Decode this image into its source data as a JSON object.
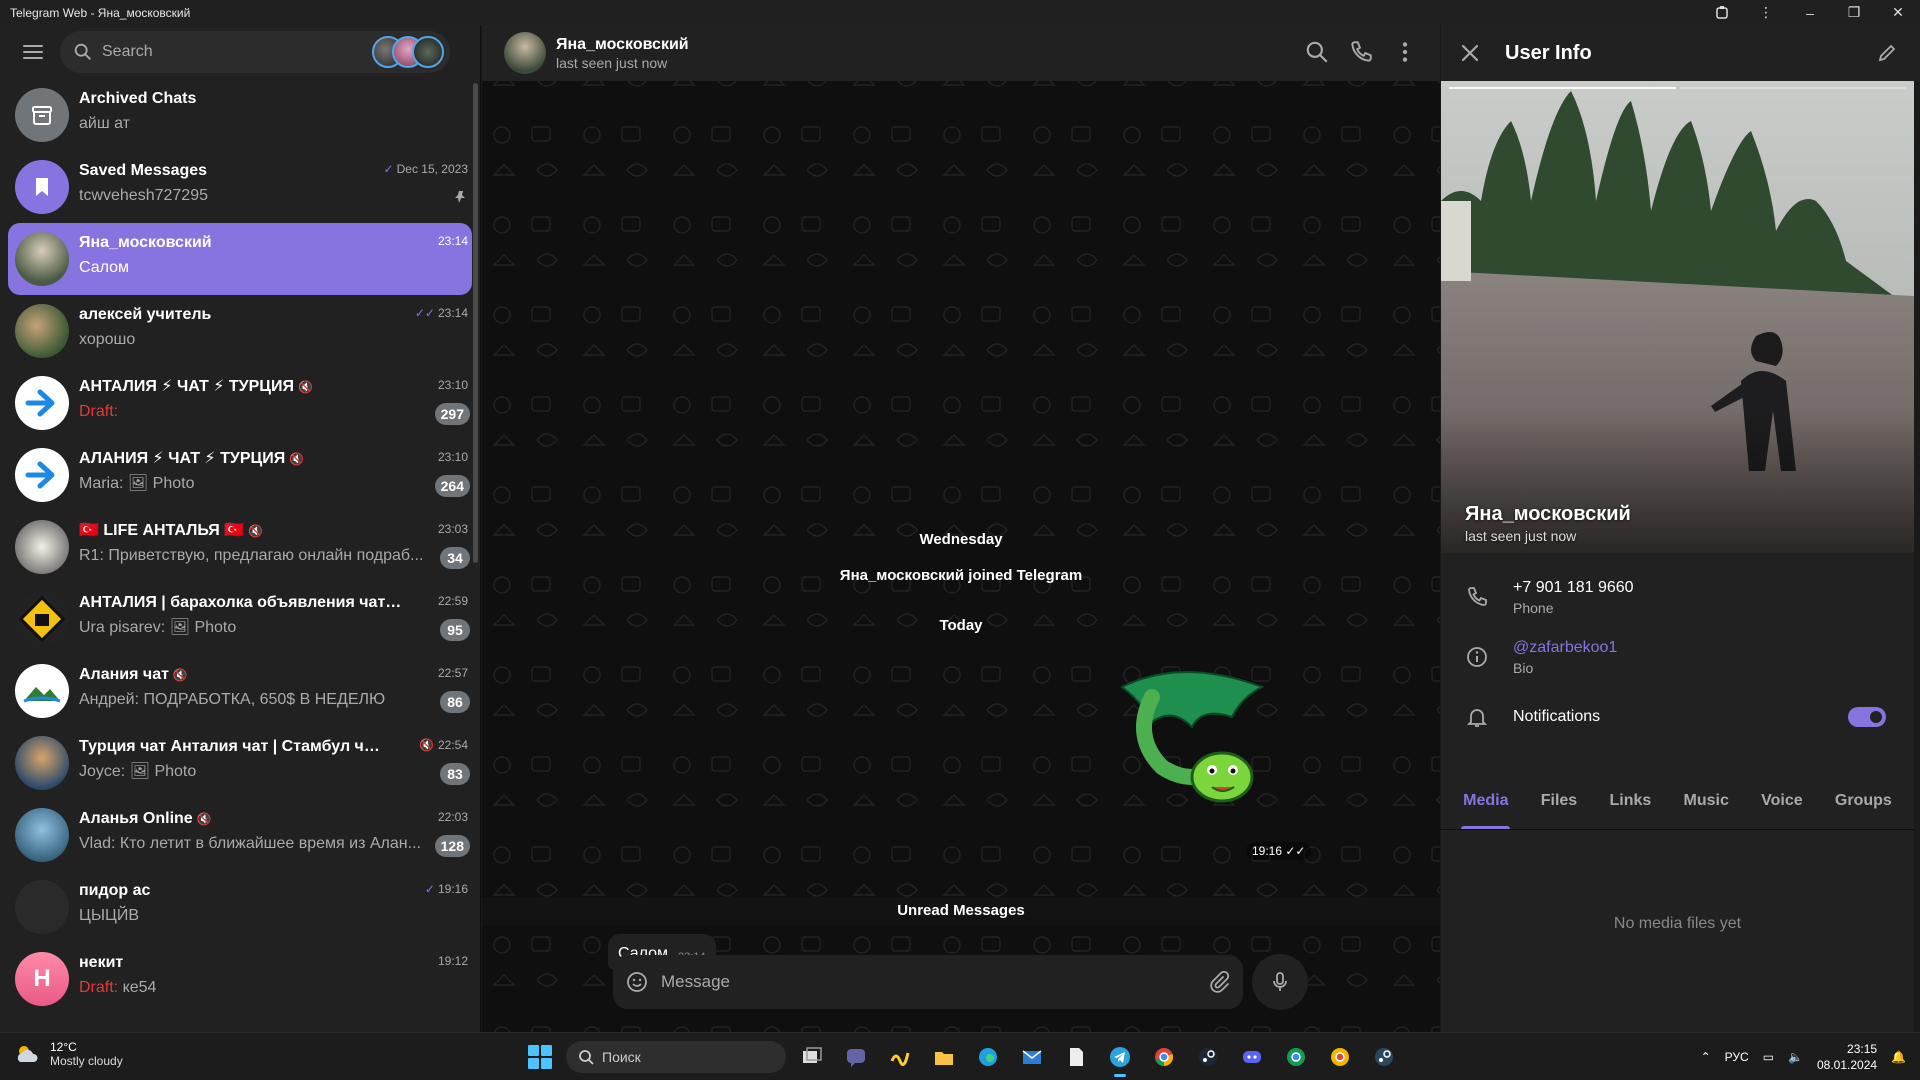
{
  "window": {
    "title": "Telegram Web - Яна_московский"
  },
  "sidebar": {
    "search_placeholder": "Search",
    "chats": [
      {
        "title": "Archived Chats",
        "subtitle": "айш ат",
        "time": "",
        "badge": "",
        "draft": ""
      },
      {
        "title": "Saved Messages",
        "subtitle": "tcwvehesh727295",
        "time": "Dec 15, 2023",
        "badge": "",
        "draft": ""
      },
      {
        "title": "Яна_московский",
        "subtitle": "Салом",
        "time": "23:14",
        "badge": "",
        "draft": ""
      },
      {
        "title": "алексей учитель",
        "subtitle": "хорошо",
        "time": "23:14",
        "badge": "",
        "draft": ""
      },
      {
        "title": "АНТАЛИЯ ⚡ ЧАТ ⚡ ТУРЦИЯ",
        "subtitle": "",
        "time": "23:10",
        "badge": "297",
        "draft": "Draft:"
      },
      {
        "title": "АЛАНИЯ ⚡ ЧАТ ⚡ ТУРЦИЯ",
        "subtitle": "Maria: 🖼 Photo",
        "time": "23:10",
        "badge": "264",
        "draft": ""
      },
      {
        "title": "🇹🇷 LIFE АНТАЛЬЯ 🇹🇷",
        "subtitle": "R1: Приветствую, предлагаю онлайн подраб...",
        "time": "23:03",
        "badge": "34",
        "draft": ""
      },
      {
        "title": "АНТАЛИЯ | барахолка объявления чат",
        "subtitle": "Ura pisarev: 🖼 Photo",
        "time": "22:59",
        "badge": "95",
        "draft": ""
      },
      {
        "title": "Алания чат",
        "subtitle": "Андрей: ПОДРАБОТКА, 650$ В НЕДЕЛЮ",
        "time": "22:57",
        "badge": "86",
        "draft": ""
      },
      {
        "title": "Турция чат Анталия чат | Стамбул чат| А...",
        "subtitle": "Joyce: 🖼 Photo",
        "time": "22:54",
        "badge": "83",
        "draft": ""
      },
      {
        "title": "Аланья Online",
        "subtitle": "Vlad: Кто летит в ближайшее время из Алан...",
        "time": "22:03",
        "badge": "128",
        "draft": ""
      },
      {
        "title": "пидор ас",
        "subtitle": "ЦЫЦЙВ",
        "time": "19:16",
        "badge": "",
        "draft": ""
      },
      {
        "title": "некит",
        "subtitle": "ке54",
        "time": "19:12",
        "badge": "",
        "draft": "Draft:",
        "avatar_letter": "Н"
      }
    ]
  },
  "chat": {
    "name": "Яна_московский",
    "status": "last seen just now",
    "service_day1": "Wednesday",
    "service_joined": "Яна_московский joined Telegram",
    "service_day2": "Today",
    "sticker_time": "19:16",
    "unread_label": "Unread Messages",
    "message_text": "Салом",
    "message_time": "23:14",
    "composer_placeholder": "Message"
  },
  "user_info": {
    "title": "User Info",
    "name": "Яна_московский",
    "status": "last seen just now",
    "phone": "+7 901 181 9660",
    "phone_label": "Phone",
    "bio": "@zafarbekoo1",
    "bio_label": "Bio",
    "notifications_label": "Notifications",
    "notifications_on": true,
    "tabs": [
      "Media",
      "Files",
      "Links",
      "Music",
      "Voice",
      "Groups"
    ],
    "empty_text": "No media files yet"
  },
  "taskbar": {
    "temperature": "12°C",
    "weather": "Mostly cloudy",
    "search_label": "Поиск",
    "lang": "РУС",
    "time": "23:15",
    "date": "08.01.2024"
  },
  "colors": {
    "accent": "#8774e1",
    "panel": "#212121",
    "background": "#0f0f0f",
    "draft": "#e53935"
  }
}
